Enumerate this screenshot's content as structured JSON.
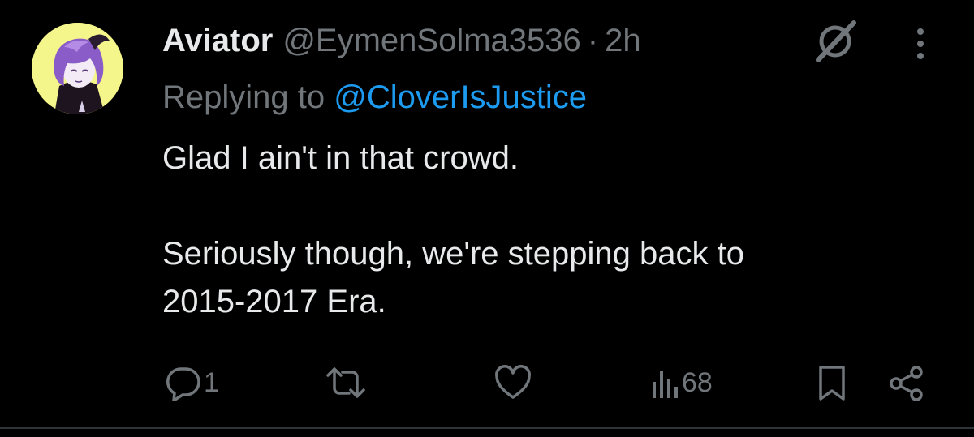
{
  "tweet": {
    "display_name": "Aviator",
    "handle": "@EymenSolma3536",
    "separator": "·",
    "time": "2h",
    "replying_prefix": "Replying to",
    "replying_to": "@CloverIsJustice",
    "text_line_1": "Glad I ain't in that crowd.",
    "text_line_2": "Seriously though, we're stepping back to",
    "text_line_3": "2015-2017 Era."
  },
  "actions": {
    "reply_count": "1",
    "views_count": "68"
  },
  "icons": {
    "grok": "grok-icon",
    "more": "more-vertical-icon",
    "reply": "reply-icon",
    "retweet": "retweet-icon",
    "like": "heart-icon",
    "views": "views-icon",
    "bookmark": "bookmark-icon",
    "share": "share-icon"
  },
  "colors": {
    "background": "#000000",
    "primary_text": "#e7e9ea",
    "secondary_text": "#71767b",
    "link": "#1d9bf0",
    "avatar_bg": "#f4f58a"
  }
}
